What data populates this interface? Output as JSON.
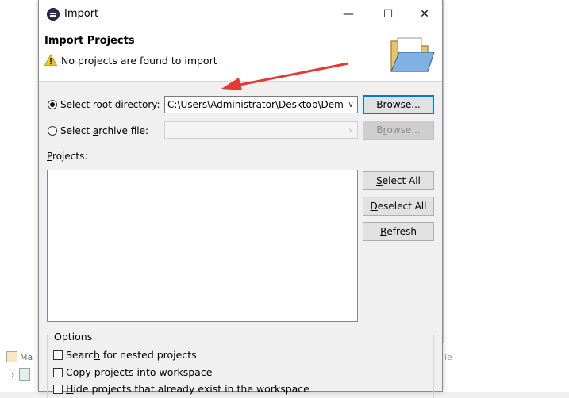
{
  "background": {
    "bottom_tab_label": "Ma",
    "bottom_right_text": "le"
  },
  "dialog": {
    "title": "Import",
    "window_controls": {
      "minimize": "—",
      "maximize": "☐",
      "close": "✕"
    },
    "header": {
      "title": "Import Projects",
      "message": "No projects are found to import"
    },
    "root_directory": {
      "label_pre": "Select roo",
      "label_u": "t",
      "label_post": " directory:",
      "checked": true,
      "value": "C:\\Users\\Administrator\\Desktop\\Dem"
    },
    "archive_file": {
      "label_pre": "Select ",
      "label_u": "a",
      "label_post": "rchive file:",
      "checked": false,
      "value": ""
    },
    "buttons": {
      "browse_root": {
        "pre": "B",
        "u": "r",
        "post": "owse..."
      },
      "browse_archive": {
        "pre": "B",
        "u": "r",
        "post": "owse..."
      },
      "select_all": {
        "pre": "",
        "u": "S",
        "post": "elect All"
      },
      "deselect_all": {
        "pre": "",
        "u": "D",
        "post": "eselect All"
      },
      "refresh": {
        "pre": "",
        "u": "R",
        "post": "efresh"
      }
    },
    "projects_label": {
      "u": "P",
      "post": "rojects:"
    },
    "options": {
      "group_label": "Options",
      "search_nested": {
        "pre": "Searc",
        "u": "h",
        "post": " for nested projects",
        "checked": false
      },
      "copy_into_workspace": {
        "pre": "",
        "u": "C",
        "post": "opy projects into workspace",
        "checked": false
      },
      "hide_existing": {
        "pre": "",
        "u": "H",
        "post": "ide projects that already exist in the workspace",
        "checked": false
      }
    }
  },
  "colors": {
    "accent": "#0078d7",
    "annotation_arrow": "#e53935",
    "warning": "#f5c518"
  }
}
